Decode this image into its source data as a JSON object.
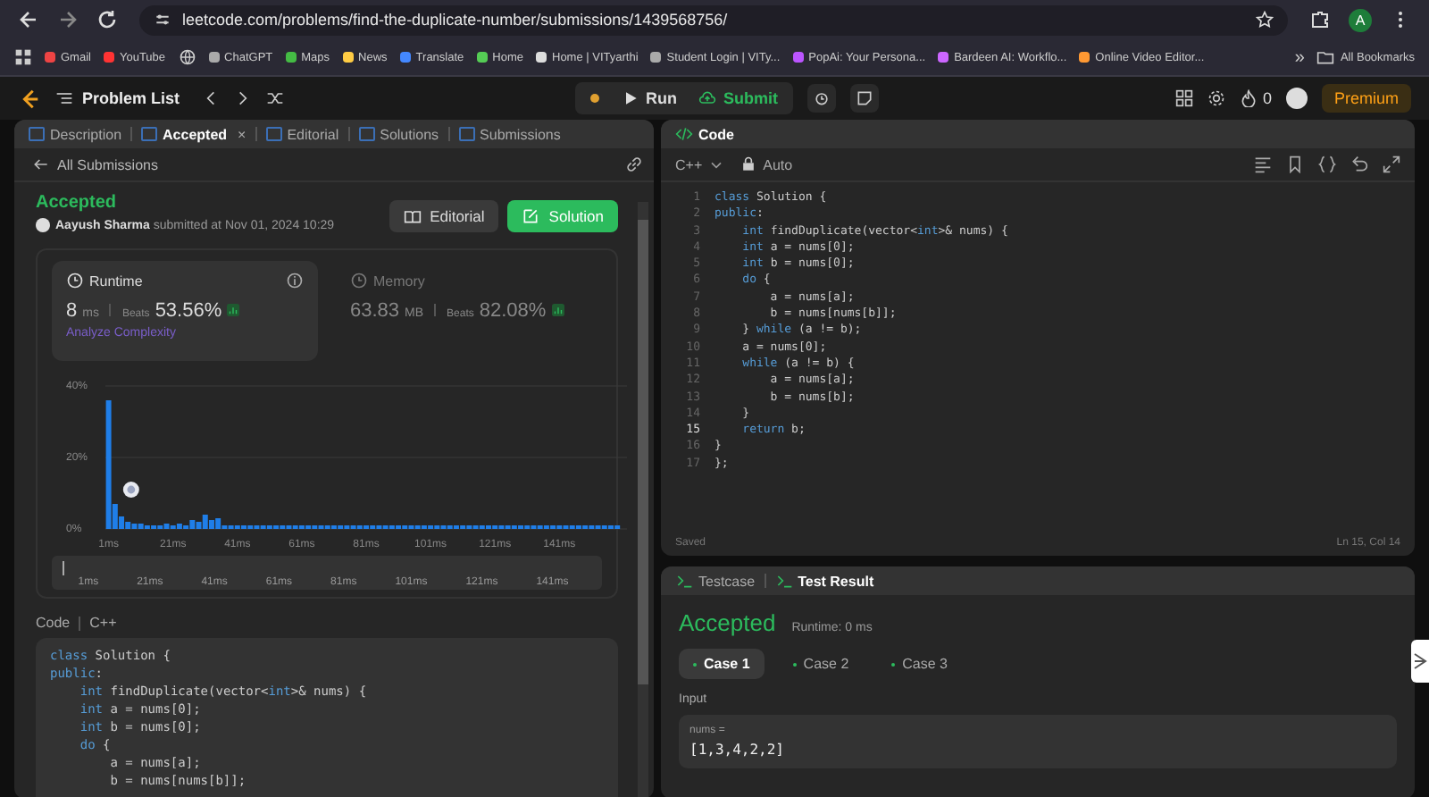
{
  "browser": {
    "url": "leetcode.com/problems/find-the-duplicate-number/submissions/1439568756/",
    "profile": "A",
    "bookmarks": [
      {
        "kind": "link",
        "label": "Gmail"
      },
      {
        "kind": "link",
        "label": "YouTube"
      },
      {
        "kind": "icon"
      },
      {
        "kind": "link",
        "label": "ChatGPT"
      },
      {
        "kind": "link",
        "label": "Maps"
      },
      {
        "kind": "link",
        "label": "News"
      },
      {
        "kind": "link",
        "label": "Translate"
      },
      {
        "kind": "link",
        "label": "Home"
      },
      {
        "kind": "link",
        "label": "Home | VITyarthi"
      },
      {
        "kind": "link",
        "label": "Student Login | VITy..."
      },
      {
        "kind": "link",
        "label": "PopAi: Your Persona..."
      },
      {
        "kind": "link",
        "label": "Bardeen AI: Workflo..."
      },
      {
        "kind": "link",
        "label": "Online Video Editor..."
      }
    ],
    "more": "»",
    "all_bookmarks": "All Bookmarks"
  },
  "header": {
    "problem_list": "Problem List",
    "run": "Run",
    "submit": "Submit",
    "streak": "0",
    "premium": "Premium"
  },
  "left_tabs": [
    {
      "label": "Description",
      "selected": false
    },
    {
      "label": "Accepted",
      "selected": true,
      "close": "×"
    },
    {
      "label": "Editorial",
      "selected": false
    },
    {
      "label": "Solutions",
      "selected": false
    },
    {
      "label": "Submissions",
      "selected": false
    }
  ],
  "submission": {
    "back": "All Submissions",
    "status": "Accepted",
    "author": "Aayush Sharma",
    "submitted": "submitted at Nov 01, 2024 10:29",
    "editorial_button": "Editorial",
    "solution_button": "Solution"
  },
  "stats": [
    {
      "title": "Runtime",
      "value": "8",
      "unit": "ms",
      "beats_label": "Beats",
      "beats": "53.56%",
      "analyze": "Analyze Complexity",
      "selected": true
    },
    {
      "title": "Memory",
      "value": "63.83",
      "unit": "MB",
      "beats_label": "Beats",
      "beats": "82.08%",
      "selected": false
    }
  ],
  "chart_data": {
    "type": "bar",
    "x": [
      1,
      3,
      5,
      7,
      9,
      11,
      13,
      15,
      17,
      19,
      21,
      23,
      25,
      27,
      29,
      31,
      33,
      35,
      37,
      39,
      41,
      43,
      45,
      47,
      49,
      51,
      53,
      55,
      57,
      59,
      61,
      63,
      65,
      67,
      69,
      71,
      73,
      75,
      77,
      79,
      81,
      83,
      85,
      87,
      89,
      91,
      93,
      95,
      97,
      99,
      101,
      103,
      105,
      107,
      109,
      111,
      113,
      115,
      117,
      119,
      121,
      123,
      125,
      127,
      129,
      131,
      133,
      135,
      137,
      139,
      141,
      143,
      145,
      147,
      149,
      151,
      153,
      155,
      157,
      159
    ],
    "values": [
      36,
      7,
      3.5,
      2,
      1.5,
      1.5,
      1,
      1,
      1,
      1.5,
      1,
      1.5,
      1,
      2.5,
      2,
      4,
      2.5,
      3,
      1,
      1,
      1,
      1,
      1,
      1,
      1,
      1,
      1,
      1,
      1,
      1,
      1,
      1,
      1,
      1,
      1,
      1,
      1,
      1,
      1,
      1,
      1,
      1,
      1,
      1,
      1,
      1,
      1,
      1,
      1,
      1,
      1,
      1,
      1,
      1,
      1,
      1,
      1,
      1,
      1,
      1,
      1,
      1,
      1,
      1,
      1,
      1,
      1,
      1,
      1,
      1,
      1,
      1,
      1,
      1,
      1,
      1,
      1,
      1,
      1,
      1
    ],
    "xlim": [
      0,
      162
    ],
    "ylim": [
      0,
      40
    ],
    "yticks": [
      {
        "value": 0,
        "label": "0%"
      },
      {
        "value": 20,
        "label": "20%"
      },
      {
        "value": 40,
        "label": "40%"
      }
    ],
    "xticks": [
      {
        "value": 1,
        "label": "1ms"
      },
      {
        "value": 21,
        "label": "21ms"
      },
      {
        "value": 41,
        "label": "41ms"
      },
      {
        "value": 61,
        "label": "61ms"
      },
      {
        "value": 81,
        "label": "81ms"
      },
      {
        "value": 101,
        "label": "101ms"
      },
      {
        "value": 121,
        "label": "121ms"
      },
      {
        "value": 141,
        "label": "141ms"
      }
    ]
  },
  "range_labels": [
    "1ms",
    "21ms",
    "41ms",
    "61ms",
    "81ms",
    "101ms",
    "121ms",
    "141ms"
  ],
  "code_section": {
    "label": "Code",
    "language": "C++",
    "lines": [
      "class Solution {",
      "public:",
      "    int findDuplicate(vector<int>& nums) {",
      "    int a = nums[0];",
      "    int b = nums[0];",
      "    do {",
      "        a = nums[a];",
      "        b = nums[nums[b]];"
    ]
  },
  "editor": {
    "title": "Code",
    "language": "C++",
    "mode": "Auto",
    "status": "Saved",
    "cursor": "Ln 15, Col 14",
    "lines": [
      {
        "n": "1",
        "code": "class Solution {",
        "active": false
      },
      {
        "n": "2",
        "code": "public:",
        "active": false
      },
      {
        "n": "3",
        "code": "    int findDuplicate(vector<int>& nums) {",
        "active": false
      },
      {
        "n": "4",
        "code": "    int a = nums[0];",
        "active": false
      },
      {
        "n": "5",
        "code": "    int b = nums[0];",
        "active": false
      },
      {
        "n": "6",
        "code": "    do {",
        "active": false
      },
      {
        "n": "7",
        "code": "        a = nums[a];",
        "active": false
      },
      {
        "n": "8",
        "code": "        b = nums[nums[b]];",
        "active": false
      },
      {
        "n": "9",
        "code": "    } while (a != b);",
        "active": false
      },
      {
        "n": "10",
        "code": "    a = nums[0];",
        "active": false
      },
      {
        "n": "11",
        "code": "    while (a != b) {",
        "active": false
      },
      {
        "n": "12",
        "code": "        a = nums[a];",
        "active": false
      },
      {
        "n": "13",
        "code": "        b = nums[b];",
        "active": false
      },
      {
        "n": "14",
        "code": "    }",
        "active": false
      },
      {
        "n": "15",
        "code": "    return b;",
        "active": true
      },
      {
        "n": "16",
        "code": "}",
        "active": false
      },
      {
        "n": "17",
        "code": "};",
        "active": false
      }
    ]
  },
  "results": {
    "tabs": [
      {
        "label": "Testcase",
        "selected": false
      },
      {
        "label": "Test Result",
        "selected": true
      }
    ],
    "status": "Accepted",
    "runtime": "Runtime: 0 ms",
    "cases": [
      {
        "label": "Case 1",
        "selected": true
      },
      {
        "label": "Case 2",
        "selected": false
      },
      {
        "label": "Case 3",
        "selected": false
      }
    ],
    "input_label": "Input",
    "param": "nums =",
    "value": "[1,3,4,2,2]"
  }
}
